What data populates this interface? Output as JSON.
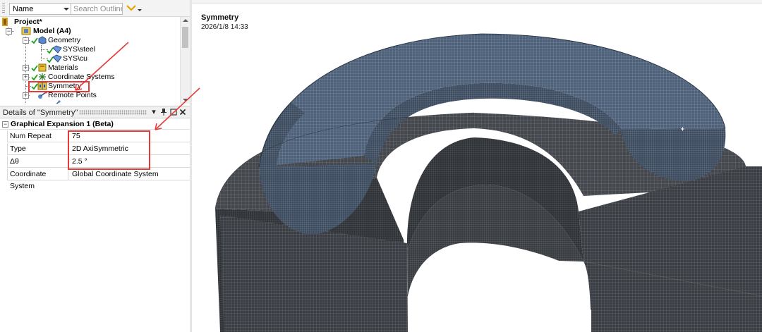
{
  "toolbar": {
    "name_select": "Name",
    "search_placeholder": "Search Outline"
  },
  "tree": {
    "items": [
      {
        "label": "Project*"
      },
      {
        "label": "Model (A4)"
      },
      {
        "label": "Geometry"
      },
      {
        "label": "SYS\\steel"
      },
      {
        "label": "SYS\\cu"
      },
      {
        "label": "Materials"
      },
      {
        "label": "Coordinate Systems"
      },
      {
        "label": "Symmetry"
      },
      {
        "label": "Remote Points"
      }
    ]
  },
  "details": {
    "title": "Details of \"Symmetry\"",
    "group": "Graphical Expansion 1 (Beta)",
    "rows": [
      {
        "name": "Num Repeat",
        "value": "75"
      },
      {
        "name": "Type",
        "value": "2D AxiSymmetric"
      },
      {
        "name": "Δθ",
        "value": "2.5 °"
      },
      {
        "name": "Coordinate System",
        "value": "Global Coordinate System"
      }
    ]
  },
  "viewport": {
    "title": "Symmetry",
    "date": "2026/1/8 14:33"
  },
  "colors": {
    "annotation": "#e53a3a",
    "mesh_dark": "#3a3d42",
    "mesh_blue": "#4d5f77"
  },
  "icons": [
    "chevron-down-icon",
    "geometry-icon",
    "body-icon",
    "materials-icon",
    "coordinate-systems-icon",
    "symmetry-icon",
    "remote-points-icon",
    "checkmark-icon",
    "pin-icon",
    "maximize-icon",
    "close-icon"
  ]
}
